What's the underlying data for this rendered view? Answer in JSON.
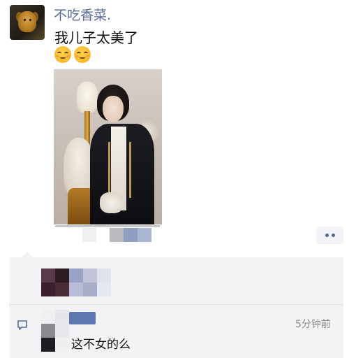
{
  "post": {
    "username": "不吃香菜.",
    "text": "我儿子太美了",
    "emojis": [
      "relieved-emoji",
      "relieved-emoji"
    ]
  },
  "comment": {
    "text": "这不女的么",
    "time": "5分钟前"
  },
  "colors": {
    "username": "#576b95",
    "comment_bg": "#f3f3f5",
    "more_button_bg": "#f1f3f6",
    "timestamp": "#8a8a8a"
  },
  "icons": {
    "more": "more-dots-icon",
    "comment": "comment-bubble-icon"
  }
}
